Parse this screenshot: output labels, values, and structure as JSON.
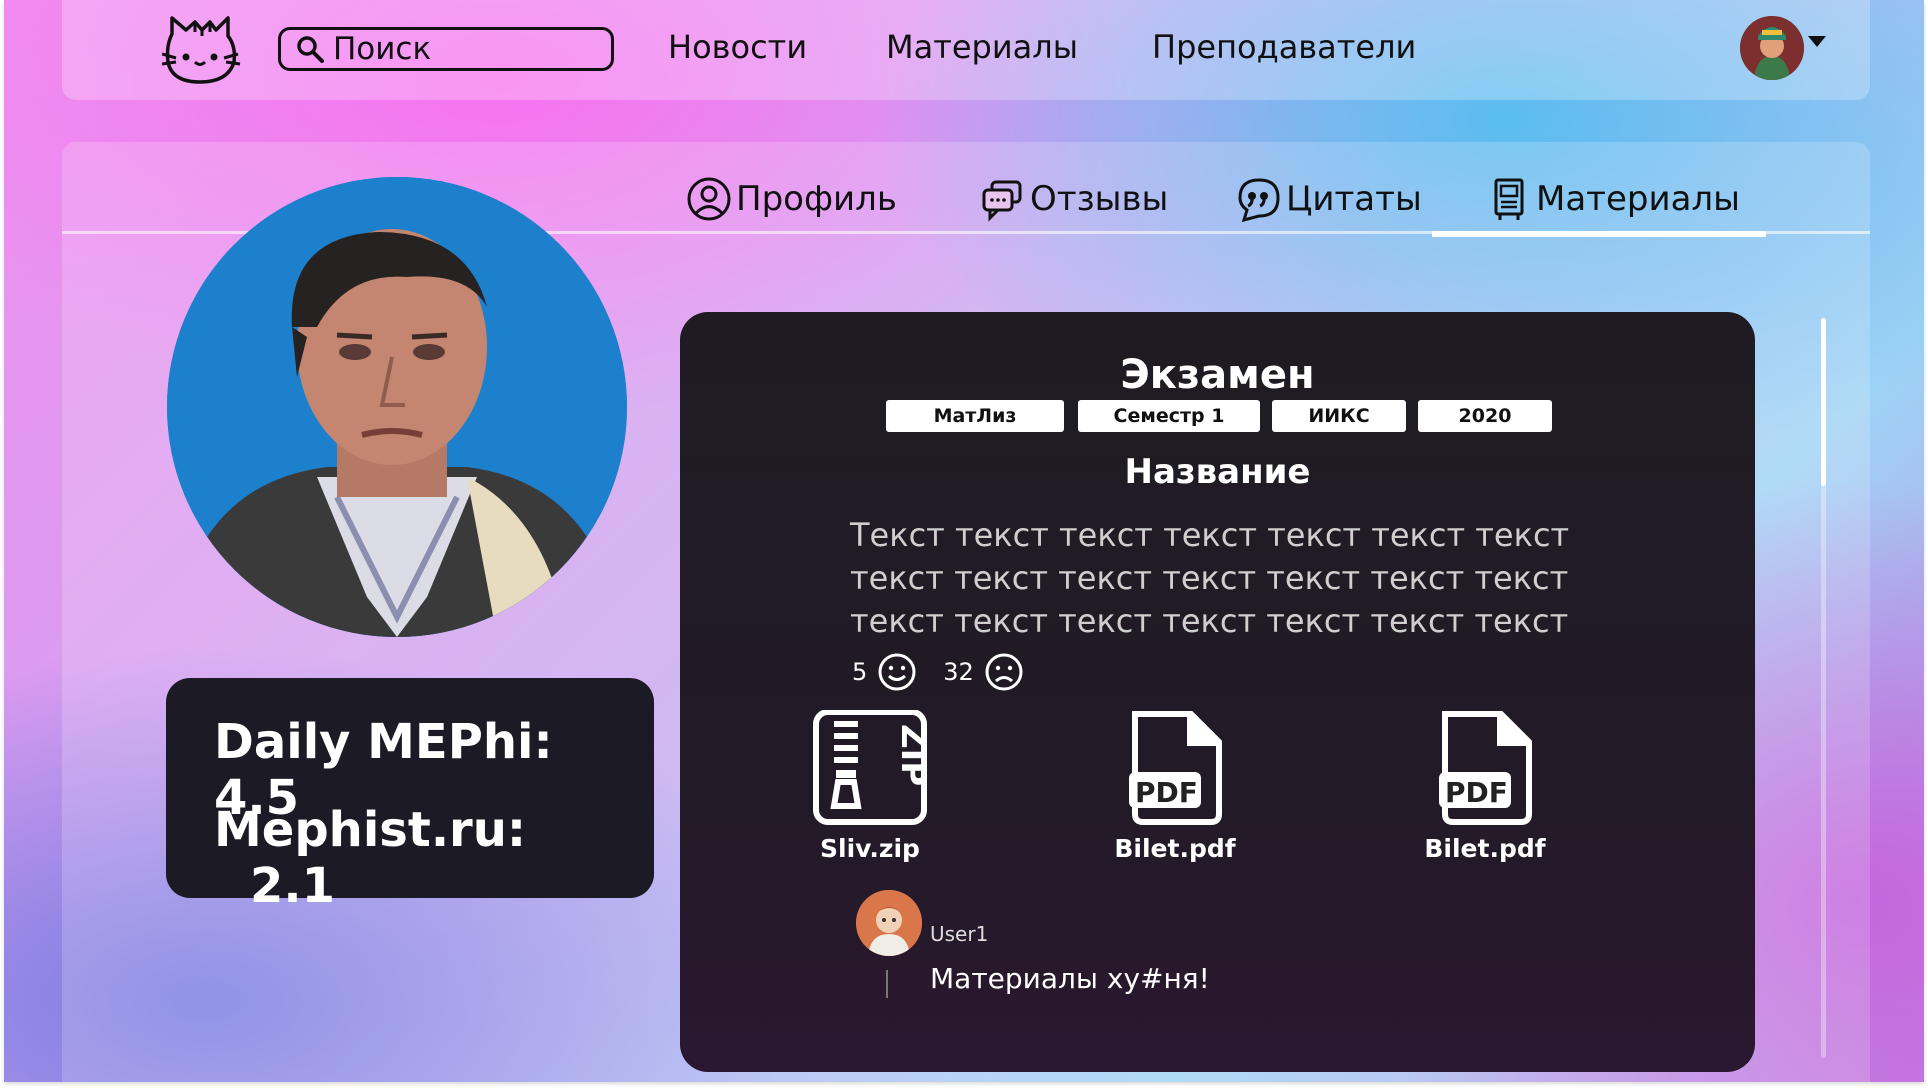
{
  "header": {
    "search_placeholder": "Поиск",
    "nav": [
      "Новости",
      "Материалы",
      "Преподаватели"
    ]
  },
  "tabs": {
    "items": [
      {
        "label": "Профиль",
        "icon": "user-circle-icon"
      },
      {
        "label": "Отзывы",
        "icon": "chat-bubbles-icon"
      },
      {
        "label": "Цитаты",
        "icon": "quote-bubble-icon"
      },
      {
        "label": "Материалы",
        "icon": "document-icon"
      }
    ],
    "active": "Материалы"
  },
  "ratings": {
    "daily_label": "Daily MEPhi:",
    "daily_value": "4.5",
    "mephist_label": "Mephist.ru:",
    "mephist_value": "2.1"
  },
  "material": {
    "title": "Экзамен",
    "tags": [
      "МатЛиз",
      "Семестр 1",
      "ИИКС",
      "2020"
    ],
    "name": "Название",
    "text_lines": [
      "Текст текст текст текст текст текст текст",
      "текст текст текст текст текст текст текст",
      "текст текст текст текст текст текст текст"
    ],
    "likes": "5",
    "dislikes": "32",
    "files": [
      {
        "name": "Sliv.zip",
        "icon": "zip-file-icon"
      },
      {
        "name": "Bilet.pdf",
        "icon": "pdf-file-icon"
      },
      {
        "name": "Bilet.pdf",
        "icon": "pdf-file-icon"
      }
    ],
    "comment": {
      "user": "User1",
      "text": "Материалы ху#ня!"
    }
  },
  "colors": {
    "card_bg": "#1e1c22",
    "ratings_bg": "#1c1a24",
    "accent_white": "#ffffff"
  }
}
